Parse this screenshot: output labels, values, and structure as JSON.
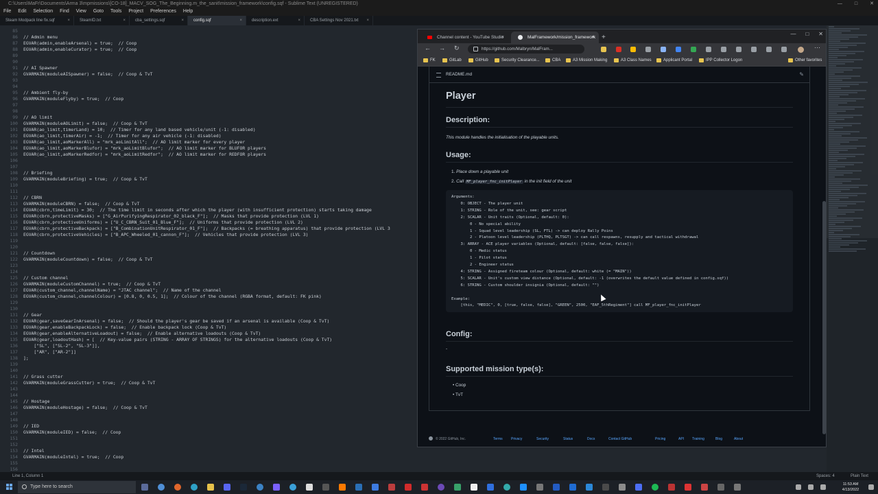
{
  "sublime": {
    "title": "C:\\Users\\MaFr\\Documents\\Arma 3\\mpmissions\\[CO-18]_MACV_SOG_The_Beginning.m_the_sanit\\mission_framework\\config.sqf - Sublime Text (UNREGISTERED)",
    "window_controls": [
      "—",
      "□",
      "✕"
    ],
    "menu": [
      "File",
      "Edit",
      "Selection",
      "Find",
      "View",
      "Goto",
      "Tools",
      "Project",
      "Preferences",
      "Help"
    ],
    "tabs": [
      {
        "label": "Steam Modpack line fix.sqf",
        "active": false
      },
      {
        "label": "SteamID.txt",
        "active": false
      },
      {
        "label": "cba_settings.sqf",
        "active": false
      },
      {
        "label": "config.sqf",
        "active": true
      },
      {
        "label": "description.ext",
        "active": false
      },
      {
        "label": "CBA Settings Nov 2021.txt",
        "active": false
      }
    ],
    "tab_close": "×",
    "line_numbers": [
      "85",
      "86",
      "87",
      "88",
      "89",
      "90",
      "91",
      "92",
      "93",
      "94",
      "95",
      "96",
      "97",
      "98",
      "99",
      "100",
      "101",
      "102",
      "103",
      "104",
      "105",
      "106",
      "107",
      "108",
      "109",
      "110",
      "111",
      "112",
      "113",
      "114",
      "115",
      "116",
      "117",
      "118",
      "119",
      "120",
      "121",
      "122",
      "123",
      "124",
      "125",
      "126",
      "127",
      "128",
      "129",
      "130",
      "131",
      "132",
      "133",
      "134",
      "135",
      "136",
      "137",
      "138",
      "139",
      "140",
      "141",
      "142",
      "143",
      "144",
      "145",
      "146",
      "147",
      "148",
      "149",
      "150",
      "151",
      "152",
      "153",
      "154",
      "155",
      "156",
      "157",
      "158",
      "159",
      "160"
    ],
    "code_lines": [
      "",
      "// Admin menu",
      "EGVAR(admin,enableArsenal) = true;  // Coop",
      "EGVAR(admin,enableCurator) = true;  // Coop",
      "",
      "",
      "// AI Spawner",
      "GVARMAIN(moduleAISpawner) = false;  // Coop & TvT",
      "",
      "",
      "// Ambient fly-by",
      "GVARMAIN(moduleFlyby) = true;  // Coop",
      "",
      "",
      "// AO limit",
      "GVARMAIN(moduleAOLimit) = false;  // Coop & TvT",
      "EGVAR(ao_limit,timerLand) = 10;  // Timer for any land based vehicle/unit (-1: disabled)",
      "EGVAR(ao_limit,timerAir) = -1;  // Timer for any air vehicle (-1: disabled)",
      "EGVAR(ao_limit,aoMarkerAll) = \"mrk_aoLimitAll\";  // AO limit marker for every player",
      "EGVAR(ao_limit,aoMarkerBlufor) = \"mrk_aoLimitBlufor\";  // AO limit marker for BLUFOR players",
      "EGVAR(ao_limit,aoMarkerRedfor) = \"mrk_aoLimitRedfor\";  // AO limit marker for REDFOR players",
      "",
      "",
      "// Briefing",
      "GVARMAIN(moduleBriefing) = true;  // Coop & TvT",
      "",
      "",
      "// CBRN",
      "GVARMAIN(moduleCBRN) = false;  // Coop & TvT",
      "EGVAR(cbrn,timeLimit) = 30;  // The time limit in seconds after which the player (with insufficient protection) starts taking damage",
      "EGVAR(cbrn,protectiveMasks) = [\"G_AirPurifyingRespirator_02_black_F\"];  // Masks that provide protection (LVL 1)",
      "EGVAR(cbrn,protectiveUniforms) = [\"U_C_CBRN_Suit_01_Blue_F\"];  // Uniforms that provide protection (LVL 2)",
      "EGVAR(cbrn,protectiveBackpack) = [\"B_CombinationUnitRespirator_01_F\"];  // Backpacks (= breathing apparatus) that provide protection (LVL 3",
      "EGVAR(cbrn,protectiveVehicles) = [\"B_APC_Wheeled_01_cannon_F\"];  // Vehicles that provide protection (LVL 3)",
      "",
      "",
      "// Countdown",
      "GVARMAIN(moduleCountdown) = false;  // Coop & TvT",
      "",
      "",
      "// Custom channel",
      "GVARMAIN(moduleCustomChannel) = true;  // Coop & TvT",
      "EGVAR(custom_channel,channelName) = \"JTAC channel\";  // Name of the channel",
      "EGVAR(custom_channel,channelColour) = [0.8, 0, 0.5, 1];  // Colour of the channel (RGBA format, default: FK pink)",
      "",
      "",
      "// Gear",
      "EGVAR(gear,saveGearInArsenal) = false;  // Should the player's gear be saved if an arsenal is available (Coop & TvT)",
      "EGVAR(gear,enableBackpackLock) = false;  // Enable backpack lock (Coop & TvT)",
      "EGVAR(gear,enableAlternativeLoadout) = false;  // Enable alternative loadouts (Coop & TvT)",
      "EGVAR(gear,loadoutHash) = [  // Key-value pairs (STRING - ARRAY OF STRINGS) for the alternative loadouts (Coop & TvT)",
      "    [\"SL\", [\"SL-2\", \"SL-3\"]],",
      "    [\"AR\", [\"AR-2\"]]",
      "];",
      "",
      "",
      "// Grass cutter",
      "GVARMAIN(moduleGrassCutter) = true;  // Coop & TvT",
      "",
      "",
      "// Hostage",
      "GVARMAIN(moduleHostage) = false;  // Coop & TvT",
      "",
      "",
      "// IED",
      "GVARMAIN(moduleIED) = false;  // Coop",
      "",
      "",
      "// Intel",
      "GVARMAIN(moduleIntel) = true;  // Coop",
      "",
      ""
    ],
    "status_left": "Line 1, Column 1",
    "status_spaces": "Spaces: 4",
    "status_syntax": "Plain Text"
  },
  "browser": {
    "tabs": [
      {
        "label": "Channel content - YouTube Studio",
        "active": false,
        "icon": "youtube-icon"
      },
      {
        "label": "MalFramework/mission_framework",
        "active": true,
        "icon": "github-icon"
      }
    ],
    "tab_close": "×",
    "new_tab": "+",
    "window_controls": [
      "—",
      "□",
      "✕"
    ],
    "nav": {
      "back": "←",
      "forward": "→",
      "reload": "↻"
    },
    "url": "https://github.com/Malbryn/MalFram...",
    "bookmarks": [
      "FK",
      "GitLab",
      "GitHub",
      "Security Clearance...",
      "CBA",
      "A3 Mission Making",
      "A3 Class Names",
      "Applicant Portal",
      "IPP Collector Logon"
    ],
    "other_favorites": "Other favorites",
    "readme": {
      "filename": "README.md",
      "title": "Player",
      "description_heading": "Description:",
      "description": "This module handles the initialisation of the playable units.",
      "usage_heading": "Usage:",
      "steps": [
        {
          "num": "1.",
          "text": "Place down a playable unit"
        },
        {
          "num": "2.",
          "pre": "Call ",
          "code": "MF_player_fnc_initPlayer",
          "post": " in the init field of the unit"
        }
      ],
      "code_block": [
        "Arguments:",
        "    0: OBJECT - The player unit",
        "    1: STRING - Role of the unit, see: gear script",
        "    2: SCALAR - Unit traits (Optional, default: 0):",
        "        0 - No special ability",
        "        1 - Squad level leadership (SL, FTL) -> can deploy Rally Poins",
        "        2 - Platoon level leadership (PLTHQ, PLTSGT) -> can call respawns, resupply and tactical withdrawal",
        "    3: ARRAY - ACE player variables (Optional, default: [false, false, false]):",
        "        0 - Medic status",
        "        1 - Pilot status",
        "        2 - Engineer status",
        "    4: STRING - Assigned fireteam colour (Optional, default: white (= \"MAIN\"))",
        "    5: SCALAR - Unit's custom view distance (Optional, default: -1 (overwrites the default value defined in config.sqf))",
        "    6: STRING - Custom shoulder insignia (Optional, default: \"\")",
        "",
        "Example:",
        "    [this, \"MEDIC\", 0, [true, false, false], \"GREEN\", 2500, \"EAF_5thRegiment\"] call MF_player_fnc_initPlayer"
      ],
      "config_heading": "Config:",
      "config_value": "-",
      "supported_heading": "Supported mission type(s):",
      "supported": [
        "Coop",
        "TvT"
      ]
    },
    "footer": {
      "copyright": "© 2022 GitHub, Inc.",
      "links": [
        "Terms",
        "Privacy",
        "Security",
        "Status",
        "Docs",
        "Contact GitHub",
        "Pricing",
        "API",
        "Training",
        "Blog",
        "About"
      ]
    }
  },
  "taskbar": {
    "search_placeholder": "Type here to search",
    "time": "11:53 AM",
    "date": "4/13/2022",
    "accent": "#6aa6e8"
  }
}
